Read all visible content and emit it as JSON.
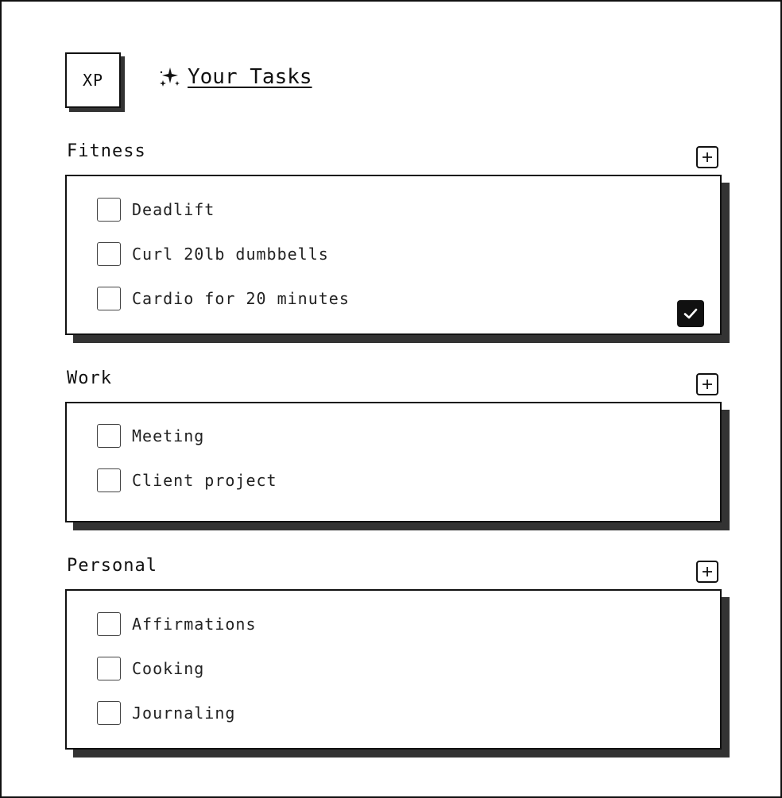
{
  "user": {
    "initials": "XP"
  },
  "header": {
    "title": "Your Tasks",
    "icon": "sparkle-icon"
  },
  "sections": [
    {
      "label": "Fitness",
      "add_icon": "plus-icon",
      "tasks": [
        {
          "label": "Deadlift",
          "checked": false
        },
        {
          "label": "Curl 20lb dumbbells",
          "checked": false
        },
        {
          "label": "Cardio for 20 minutes",
          "checked": false
        }
      ],
      "done_icon": "check-icon"
    },
    {
      "label": "Work",
      "add_icon": "plus-icon",
      "tasks": [
        {
          "label": "Meeting",
          "checked": false
        },
        {
          "label": "Client project",
          "checked": false
        }
      ]
    },
    {
      "label": "Personal",
      "add_icon": "plus-icon",
      "tasks": [
        {
          "label": "Affirmations",
          "checked": false
        },
        {
          "label": "Cooking",
          "checked": false
        },
        {
          "label": "Journaling",
          "checked": false
        }
      ]
    }
  ],
  "colors": {
    "ink": "#111111",
    "shadow": "#333333",
    "background": "#ffffff"
  }
}
